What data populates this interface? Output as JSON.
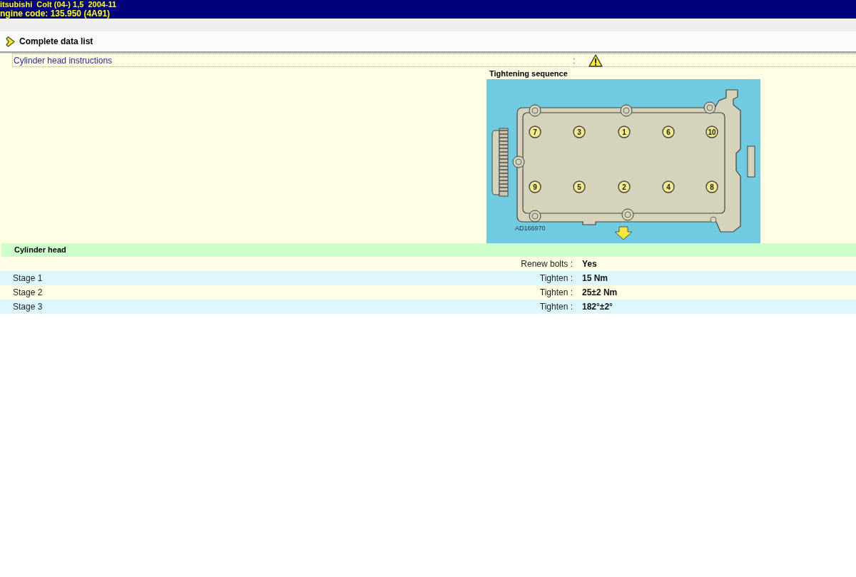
{
  "header": {
    "vehicle": "itsubishi  Colt (04-) 1,5  2004-11",
    "engine_code": "ngine code: 135.950 (4A91)"
  },
  "toolbar": {
    "button": "Complete data list"
  },
  "instructions": {
    "label": "Cylinder head instructions",
    "separator": ":"
  },
  "diagram": {
    "title": "Tightening sequence",
    "bolt_rows": [
      [
        "7",
        "3",
        "1",
        "6",
        "10"
      ],
      [
        "9",
        "5",
        "2",
        "4",
        "8"
      ]
    ],
    "code": "AD166970"
  },
  "section": {
    "title": "Cylinder head",
    "rows": [
      {
        "label": "Renew bolts :",
        "value": "Yes"
      },
      {
        "stage": "Stage 1",
        "label": "Tighten :",
        "value": "15 Nm"
      },
      {
        "stage": "Stage 2",
        "label": "Tighten :",
        "value": "25±2 Nm"
      },
      {
        "stage": "Stage 3",
        "label": "Tighten :",
        "value": "182°±2°"
      }
    ]
  }
}
